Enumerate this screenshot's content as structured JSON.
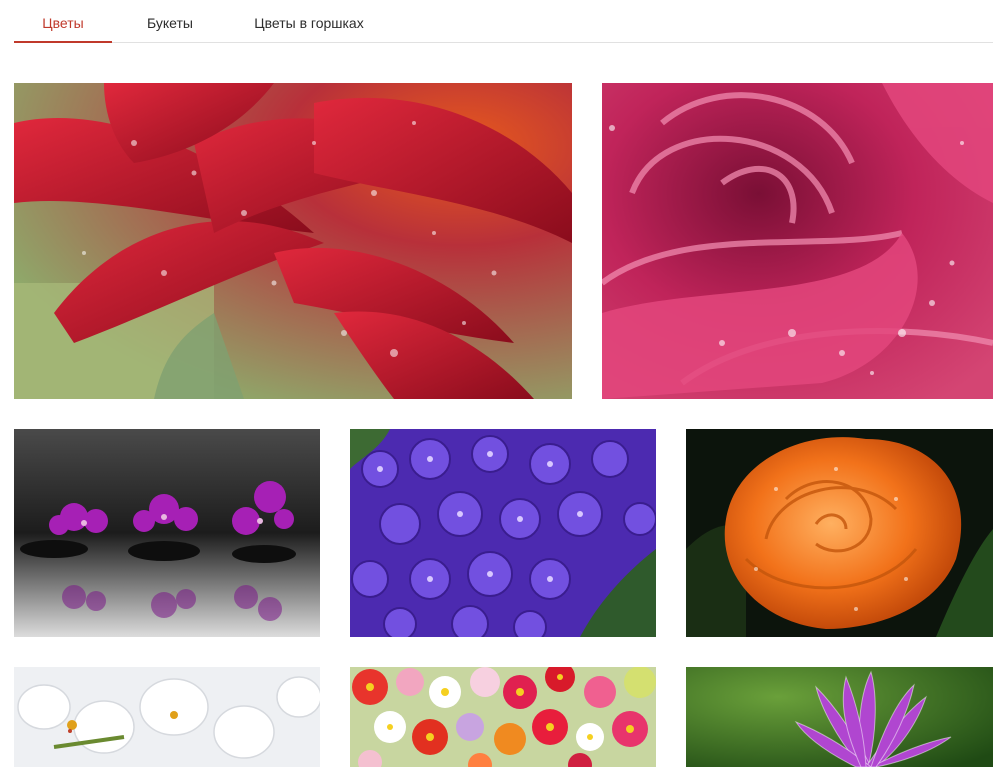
{
  "tabs": {
    "items": [
      {
        "label": "Цветы",
        "active": true
      },
      {
        "label": "Букеты",
        "active": false
      },
      {
        "label": "Цветы в горшках",
        "active": false
      }
    ]
  },
  "colors": {
    "accent": "#c0392b",
    "text": "#2d2d2d",
    "divider": "#e1e1e1"
  },
  "gallery": {
    "photos": [
      {
        "subject": "red-gerbera-dewdrops"
      },
      {
        "subject": "pink-rose-dewdrops"
      },
      {
        "subject": "purple-orchids-on-stones"
      },
      {
        "subject": "purple-lilac-cluster"
      },
      {
        "subject": "orange-rose-dark-background"
      },
      {
        "subject": "white-orchids"
      },
      {
        "subject": "mixed-gerbera-flowers"
      },
      {
        "subject": "purple-daisy-green-background"
      }
    ]
  }
}
